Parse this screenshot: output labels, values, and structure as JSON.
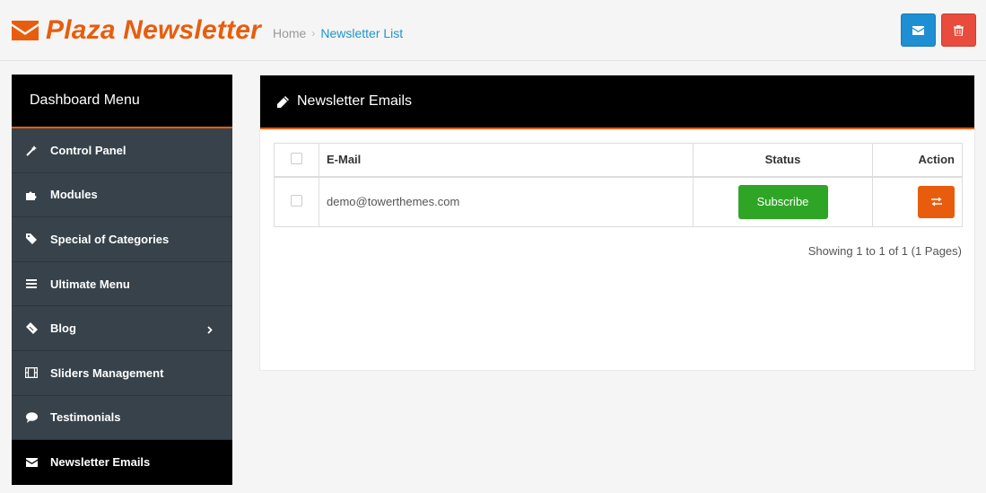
{
  "header": {
    "logo_text": "Plaza Newsletter",
    "breadcrumb": {
      "home": "Home",
      "separator": "›",
      "current": "Newsletter List"
    },
    "colors": {
      "brand": "#e85d0d",
      "mail_button": "#1f8fd4",
      "delete_button": "#e74c3c"
    },
    "buttons": [
      {
        "name": "send-mail-button",
        "icon": "envelope-icon"
      },
      {
        "name": "delete-button",
        "icon": "trash-icon"
      }
    ]
  },
  "sidebar": {
    "title": "Dashboard Menu",
    "items": [
      {
        "label": "Control Panel",
        "icon": "magic-wand-icon"
      },
      {
        "label": "Modules",
        "icon": "puzzle-icon"
      },
      {
        "label": "Special of Categories",
        "icon": "tag-icon"
      },
      {
        "label": "Ultimate Menu",
        "icon": "bars-icon"
      },
      {
        "label": "Blog",
        "icon": "ticket-icon",
        "has_submenu": true
      },
      {
        "label": "Sliders Management",
        "icon": "film-icon"
      },
      {
        "label": "Testimonials",
        "icon": "comment-icon"
      },
      {
        "label": "Newsletter Emails",
        "icon": "envelope-icon",
        "active": true
      }
    ]
  },
  "panel": {
    "title": "Newsletter Emails",
    "table": {
      "columns": [
        "",
        "E-Mail",
        "Status",
        "Action"
      ],
      "rows": [
        {
          "email": "demo@towerthemes.com",
          "status": "Subscribe",
          "checked": false
        }
      ]
    },
    "pagination": "Showing 1 to 1 of 1 (1 Pages)"
  }
}
